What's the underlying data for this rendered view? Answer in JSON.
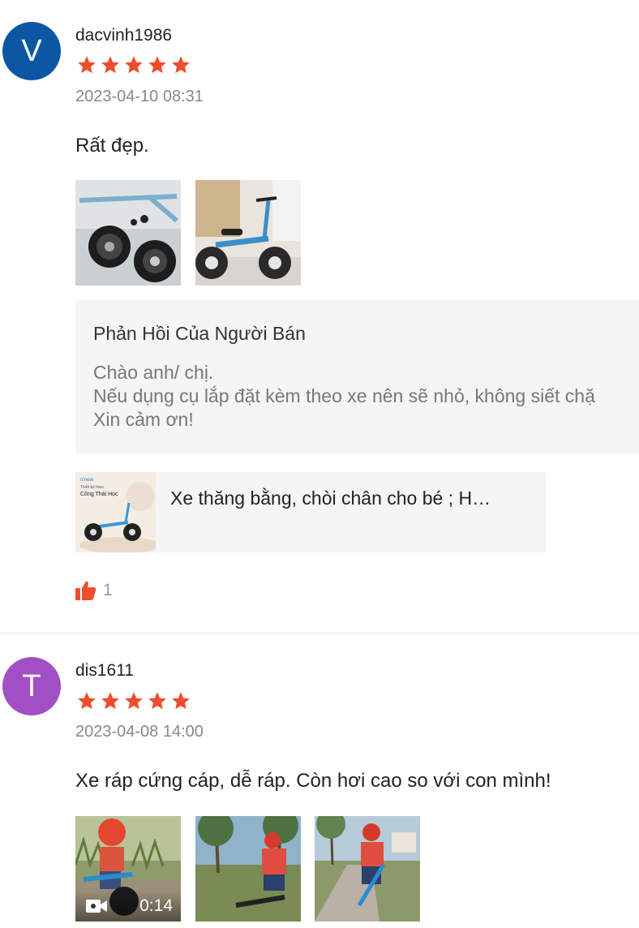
{
  "reviews": [
    {
      "avatar_letter": "V",
      "avatar_color": "#0b57a4",
      "username": "dacvinh1986",
      "rating": 5,
      "date": "2023-04-10 08:31",
      "comment": "Rất đẹp.",
      "media": [
        {
          "kind": "image",
          "description": "bike-parts-photo"
        },
        {
          "kind": "image",
          "description": "assembled-blue-balance-bike-photo"
        }
      ],
      "seller_reply": {
        "title": "Phản Hồi Của Người Bán",
        "lines": [
          "Chào anh/ chị.",
          "Nếu dụng cụ lắp đặt kèm theo xe nên sẽ nhỏ, không siết chặ",
          "Xin cảm ơn!"
        ]
      },
      "product": {
        "name": "Xe thăng bằng, chòi chân cho bé ; H…",
        "thumb_text": {
          "brand": "ninete",
          "line1": "Thiết kế theo",
          "line2": "Công Thái Học"
        }
      },
      "likes": "1"
    },
    {
      "avatar_letter": "T",
      "avatar_color": "#a14fc4",
      "username": "dis1611",
      "rating": 5,
      "date": "2023-04-08 14:00",
      "comment": "Xe ráp cứng cáp, dễ ráp. Còn hơi cao so với con mình!",
      "media": [
        {
          "kind": "video",
          "duration": "0:14"
        },
        {
          "kind": "image",
          "description": "child-riding-bike-photo"
        },
        {
          "kind": "image",
          "description": "child-on-path-photo"
        }
      ]
    }
  ],
  "colors": {
    "star": "#ee4d2d",
    "like": "#ee4d2d"
  }
}
